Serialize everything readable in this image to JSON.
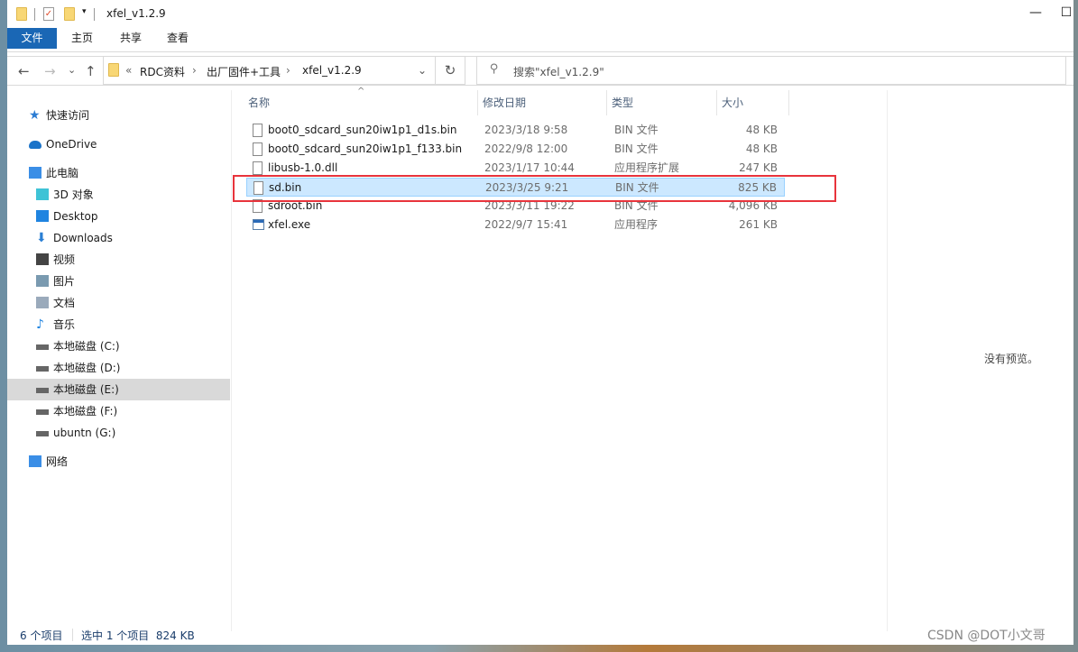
{
  "window": {
    "title": "xfel_v1.2.9",
    "minimize": "—",
    "maximize": "☐"
  },
  "ribbon": {
    "tabs": [
      "文件",
      "主页",
      "共享",
      "查看"
    ]
  },
  "nav_buttons": {
    "back": "←",
    "forward": "→",
    "recent": "⌄",
    "up": "↑"
  },
  "address": {
    "prefix": "«",
    "crumbs": [
      "RDC资料",
      "出厂固件+工具",
      "xfel_v1.2.9"
    ],
    "separator": "›",
    "dropdown": "⌄",
    "refresh": "↻"
  },
  "search": {
    "placeholder": "搜索\"xfel_v1.2.9\"",
    "icon": "search-icon"
  },
  "sidebar": {
    "items": [
      {
        "label": "快速访问",
        "icon": "star-icon",
        "color": "#2b7cd3"
      },
      {
        "label": "OneDrive",
        "icon": "cloud-icon",
        "color": "#1a73c9"
      },
      {
        "label": "此电脑",
        "icon": "computer-icon",
        "color": "#3a8ee6"
      },
      {
        "label": "3D 对象",
        "icon": "cube-icon",
        "color": "#3ec3d6"
      },
      {
        "label": "Desktop",
        "icon": "desktop-icon",
        "color": "#1f84e0"
      },
      {
        "label": "Downloads",
        "icon": "download-icon",
        "color": "#2a7fd4"
      },
      {
        "label": "视频",
        "icon": "video-icon",
        "color": "#444444"
      },
      {
        "label": "图片",
        "icon": "picture-icon",
        "color": "#7a9ab0"
      },
      {
        "label": "文档",
        "icon": "document-icon",
        "color": "#9aaabb"
      },
      {
        "label": "音乐",
        "icon": "music-icon",
        "color": "#1f84e0"
      },
      {
        "label": "本地磁盘 (C:)",
        "icon": "drive-icon",
        "color": "#666666"
      },
      {
        "label": "本地磁盘 (D:)",
        "icon": "drive-icon",
        "color": "#666666"
      },
      {
        "label": "本地磁盘 (E:)",
        "icon": "drive-icon",
        "color": "#666666",
        "selected": true
      },
      {
        "label": "本地磁盘 (F:)",
        "icon": "drive-icon",
        "color": "#666666"
      },
      {
        "label": "ubuntn (G:)",
        "icon": "drive-icon",
        "color": "#666666"
      },
      {
        "label": "网络",
        "icon": "network-icon",
        "color": "#3a8ee6"
      }
    ]
  },
  "columns": {
    "name": "名称",
    "date": "修改日期",
    "type": "类型",
    "size": "大小",
    "sort_indicator": "^"
  },
  "files": [
    {
      "name": "boot0_sdcard_sun20iw1p1_d1s.bin",
      "date": "2023/3/18 9:58",
      "type": "BIN 文件",
      "size": "48 KB"
    },
    {
      "name": "boot0_sdcard_sun20iw1p1_f133.bin",
      "date": "2022/9/8 12:00",
      "type": "BIN 文件",
      "size": "48 KB"
    },
    {
      "name": "libusb-1.0.dll",
      "date": "2023/1/17 10:44",
      "type": "应用程序扩展",
      "size": "247 KB"
    },
    {
      "name": "sd.bin",
      "date": "2023/3/25 9:21",
      "type": "BIN 文件",
      "size": "825 KB",
      "selected": true
    },
    {
      "name": "sdroot.bin",
      "date": "2023/3/11 19:22",
      "type": "BIN 文件",
      "size": "4,096 KB"
    },
    {
      "name": "xfel.exe",
      "date": "2022/9/7 15:41",
      "type": "应用程序",
      "size": "261 KB"
    }
  ],
  "preview": {
    "text": "没有预览。"
  },
  "status": {
    "count": "6 个项目",
    "selection": "选中 1 个项目  824 KB"
  },
  "watermark": "CSDN @DOT小文哥",
  "highlight_color": "#e8343c"
}
